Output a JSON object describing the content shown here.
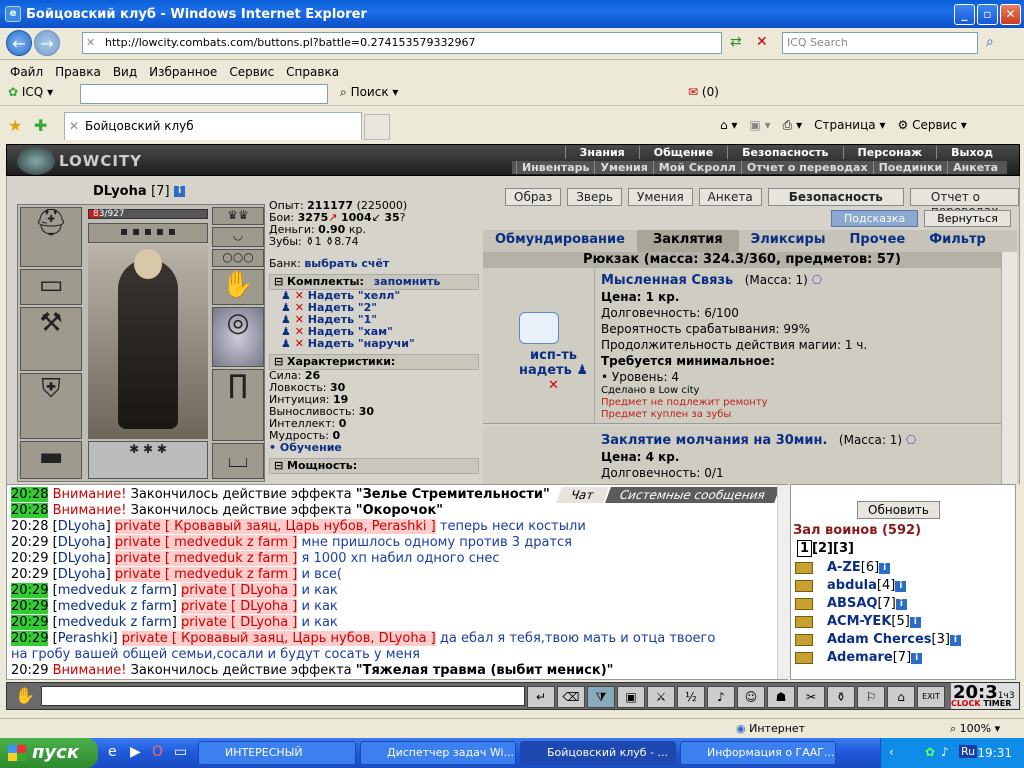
{
  "window": {
    "title": "Бойцовский клуб - Windows Internet Explorer"
  },
  "address": {
    "url": "http://lowcity.combats.com/buttons.pl?battle=0.274153579332967",
    "search_placeholder": "ICQ Search"
  },
  "menu": [
    "Файл",
    "Правка",
    "Вид",
    "Избранное",
    "Сервис",
    "Справка"
  ],
  "toolbar": {
    "icq": "ICQ",
    "search": "Поиск",
    "count": "(0)"
  },
  "browser_tab": {
    "title": "Бойцовский клуб",
    "page": "Страница",
    "service": "Сервис"
  },
  "game_logo": "LOWCITY",
  "top_nav": [
    "Знания",
    "Общение",
    "Безопасность",
    "Персонаж",
    "Выход"
  ],
  "top_nav2": [
    "Инвентарь",
    "Умения",
    "Мой Скролл",
    "Отчет о переводах",
    "Поединки",
    "Анкета"
  ],
  "character": {
    "name": "DLyoha",
    "level": "[7]",
    "hp": "83/927",
    "hp_fraction": 0.09
  },
  "stats": {
    "exp_label": "Опыт:",
    "exp": "211177",
    "exp_next": "(225000)",
    "fights_label": "Бои:",
    "wins": "3275",
    "losses": "1004",
    "draws": "35",
    "money_label": "Деньги:",
    "money": "0.90",
    "money_unit": "кр.",
    "teeth_label": "Зубы:",
    "teeth1": "1",
    "teeth2": "8.74",
    "bank_label": "Банк:",
    "bank_link": "выбрать счёт",
    "kits_label": "Комплекты:",
    "kits_remember": "запомнить",
    "kits": [
      "Надеть \"хелл\"",
      "Надеть \"2\"",
      "Надеть \"1\"",
      "Надеть \"хам\"",
      "Надеть \"наручи\""
    ],
    "chars_label": "Характеристики:",
    "attrs": [
      {
        "label": "Сила:",
        "value": "26"
      },
      {
        "label": "Ловкость:",
        "value": "30"
      },
      {
        "label": "Интуиция:",
        "value": "19"
      },
      {
        "label": "Выносливость:",
        "value": "30"
      },
      {
        "label": "Интеллект:",
        "value": "0"
      },
      {
        "label": "Мудрость:",
        "value": "0"
      }
    ],
    "training": "Обучение",
    "power_label": "Мощность:"
  },
  "top_buttons": [
    "Образ",
    "Зверь",
    "Умения",
    "Анкета",
    "Безопасность",
    "Отчет о переводах"
  ],
  "hint_buttons": [
    "Подсказка",
    "Вернуться"
  ],
  "inventory_tabs": [
    "Обмундирование",
    "Заклятия",
    "Эликсиры",
    "Прочее",
    "Фильтр"
  ],
  "backpack": "Рюкзак (масса: 324.3/360, предметов: 57)",
  "item1": {
    "use": "исп-ть",
    "wear": "надеть",
    "name": "Мысленная Связь",
    "mass": "(Масса: 1)",
    "price": "Цена: 1 кр.",
    "durability": "Долговечность: 6/100",
    "chance": "Вероятность срабатывания: 99%",
    "duration": "Продолжительность действия магии: 1 ч.",
    "req": "Требуется минимальное:",
    "level": "• Уровень: 4",
    "made": "Сделано в Low city",
    "no_repair": "Предмет не подлежит ремонту",
    "bought": "Предмет куплен за зубы"
  },
  "item2": {
    "name": "Заклятие молчания на 30мин.",
    "mass": "(Масса: 1)",
    "price": "Цена: 4 кр.",
    "durability": "Долговечность: 0/1"
  },
  "chat_tabs": [
    "Чат",
    "Системные сообщения"
  ],
  "chat": [
    {
      "t": "20:28",
      "green": true,
      "warn": "Внимание!",
      "text": "Закончилось действие эффекта ",
      "bold": "\"Зелье Стремительности\""
    },
    {
      "t": "20:28",
      "green": true,
      "warn": "Внимание!",
      "text": "Закончилось действие эффекта ",
      "bold": "\"Окорочок\""
    },
    {
      "t": "20:28",
      "nick": "DLyoha",
      "priv": "private [ Кровавый заяц, Царь нубов, Perashki ]",
      "msg": "теперь неси костыли"
    },
    {
      "t": "20:29",
      "nick": "DLyoha",
      "priv": "private [ medveduk z farm ]",
      "msg": "мне пришлось одному против 3 дратся"
    },
    {
      "t": "20:29",
      "nick": "DLyoha",
      "priv": "private [ medveduk z farm ]",
      "msg": "я 1000 хп набил одного снес"
    },
    {
      "t": "20:29",
      "nick": "DLyoha",
      "priv": "private [ medveduk z farm ]",
      "msg": "и все("
    },
    {
      "t": "20:29",
      "green": true,
      "nick": "medveduk z farm",
      "priv": "private [ DLyoha ]",
      "msg": "и как"
    },
    {
      "t": "20:29",
      "green": true,
      "nick": "medveduk z farm",
      "priv": "private [ DLyoha ]",
      "msg": "и как"
    },
    {
      "t": "20:29",
      "green": true,
      "nick": "medveduk z farm",
      "priv": "private [ DLyoha ]",
      "msg": "и как"
    },
    {
      "t": "20:29",
      "green": true,
      "nick": "Perashki",
      "priv": "private [ Кровавый заяц, Царь нубов, DLyoha ]",
      "msg": "да ебал я тебя,твою мать и отца твоего"
    },
    {
      "cont": "на гробу вашей общей семьи,сосали и будут сосать у меня"
    },
    {
      "t": "20:29",
      "warn": "Внимание!",
      "text": "Закончилось действие эффекта ",
      "bold": "\"Тяжелая травма (выбит мениск)\""
    }
  ],
  "users_panel": {
    "refresh": "Обновить",
    "hall": "Зал воинов (592)",
    "pages": [
      "1",
      "2",
      "3"
    ],
    "users": [
      {
        "name": "A-ZE",
        "lvl": "[6]"
      },
      {
        "name": "abdula",
        "lvl": "[4]"
      },
      {
        "name": "ABSAQ",
        "lvl": "[7]"
      },
      {
        "name": "ACM-YEK",
        "lvl": "[5]"
      },
      {
        "name": "Adam Cherces",
        "lvl": "[3]"
      },
      {
        "name": "Ademare",
        "lvl": "[7]"
      }
    ]
  },
  "clock": {
    "time": "20:3",
    "clock_label": "CLOCK",
    "timer_label": "TIMER",
    "sub": "1ч3"
  },
  "statusbar": {
    "zone": "Интернет",
    "zoom": "100%"
  },
  "taskbar": {
    "start": "пуск",
    "tasks": [
      "ИНТЕРЕСНЫЙ",
      "Диспетчер задач Wi...",
      "Бойцовский клуб - ...",
      "Информация о ГААГ..."
    ],
    "lang": "Ru",
    "time": "19:31"
  },
  "colors": {
    "title_blue": "#0a5fd8",
    "hp_red": "#c02020",
    "link_blue": "#0a2e86",
    "private_red": "#cc0000",
    "green_ts": "#33cc33"
  }
}
